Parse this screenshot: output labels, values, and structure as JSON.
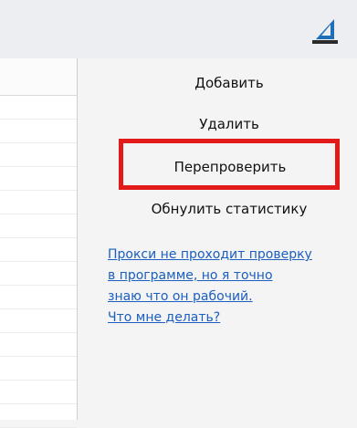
{
  "buttons": {
    "add": "Добавить",
    "delete": "Удалить",
    "recheck": "Перепроверить",
    "reset_stats": "Обнулить статистику"
  },
  "help": {
    "line1": "Прокси не проходит проверку",
    "line2": "в программе, но я точно",
    "line3": "знаю что он рабочий.",
    "line4": "Что мне делать?"
  },
  "colors": {
    "highlight": "#e21a1a",
    "link": "#1b5fbf"
  }
}
